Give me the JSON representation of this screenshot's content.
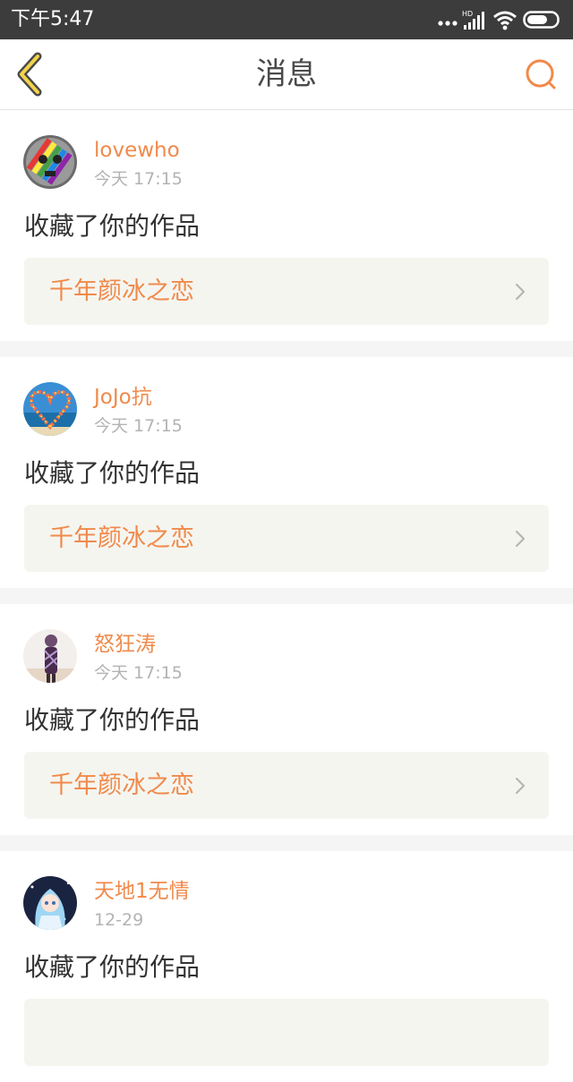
{
  "status_bar": {
    "time": "下午5:47",
    "icons": [
      "more-dots-icon",
      "hd-signal-icon",
      "wifi-icon",
      "battery-icon"
    ],
    "hd_label": "HD"
  },
  "nav": {
    "title": "消息",
    "back_icon": "back-chevron-icon",
    "search_icon": "search-icon",
    "accent_color": "#f08a4b"
  },
  "messages": [
    {
      "user": "lovewho",
      "time": "今天 17:15",
      "text": "收藏了你的作品",
      "work_title": "千年颜冰之恋"
    },
    {
      "user": "JoJo抗",
      "time": "今天 17:15",
      "text": "收藏了你的作品",
      "work_title": "千年颜冰之恋"
    },
    {
      "user": "怒狂涛",
      "time": "今天 17:15",
      "text": "收藏了你的作品",
      "work_title": "千年颜冰之恋"
    },
    {
      "user": "天地1无情",
      "time": "12-29",
      "text": "收藏了你的作品",
      "work_title": ""
    }
  ]
}
